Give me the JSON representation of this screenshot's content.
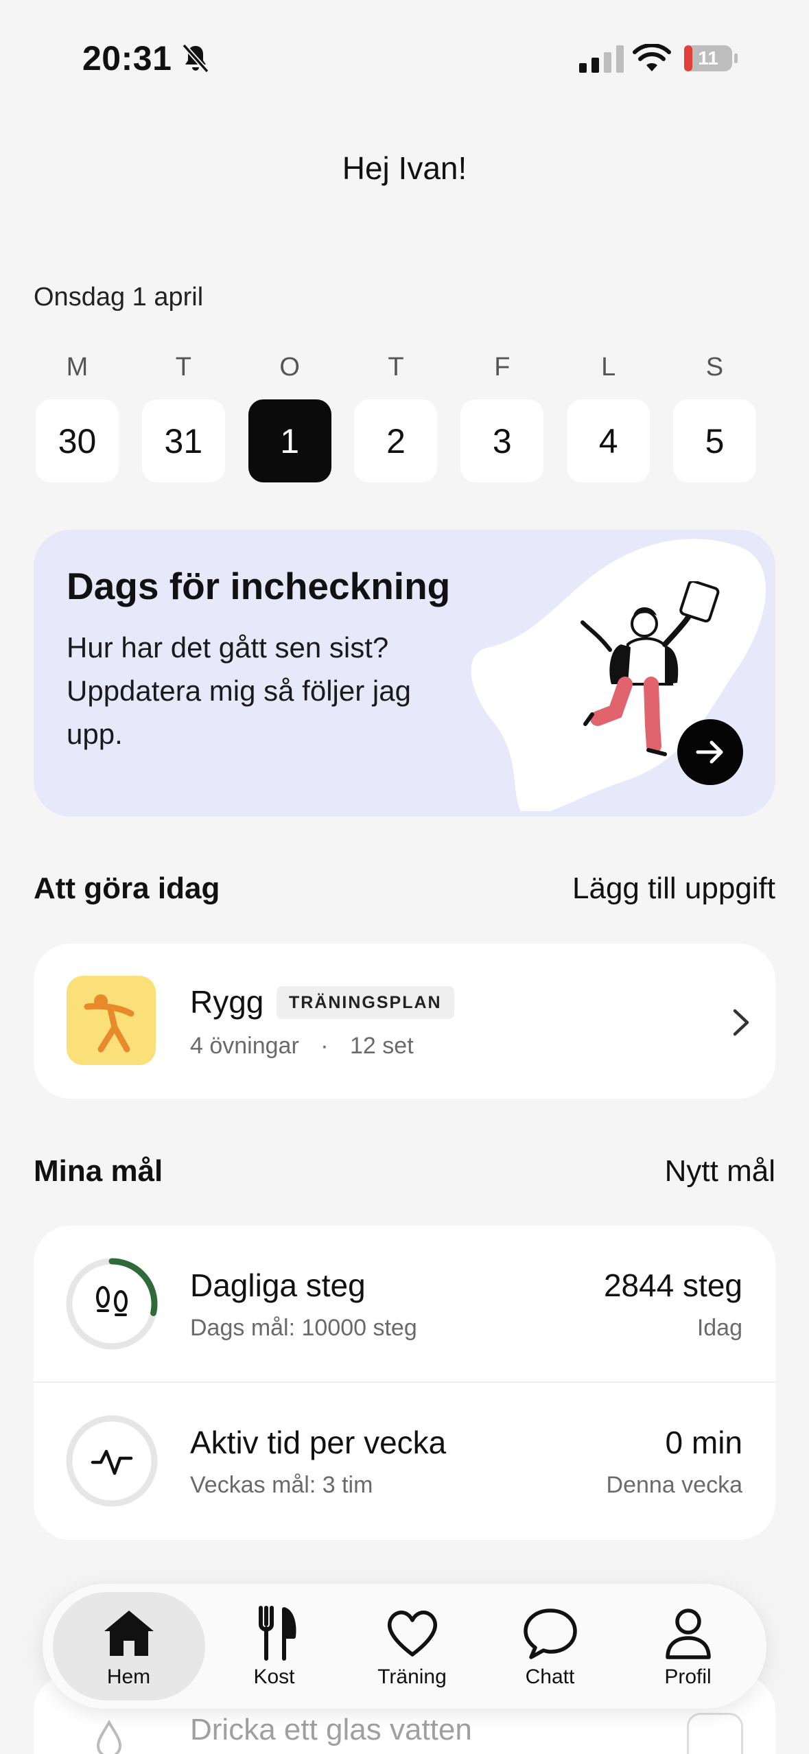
{
  "status_bar": {
    "time": "20:31",
    "battery": "11"
  },
  "greeting": "Hej Ivan!",
  "date_label": "Onsdag 1 april",
  "week": [
    {
      "letter": "M",
      "day": "30"
    },
    {
      "letter": "T",
      "day": "31"
    },
    {
      "letter": "O",
      "day": "1"
    },
    {
      "letter": "T",
      "day": "2"
    },
    {
      "letter": "F",
      "day": "3"
    },
    {
      "letter": "L",
      "day": "4"
    },
    {
      "letter": "S",
      "day": "5"
    }
  ],
  "selected_day": "1",
  "checkin": {
    "title": "Dags för incheckning",
    "text": "Hur har det gått sen sist? Uppdatera mig så följer jag upp."
  },
  "todo": {
    "title": "Att göra idag",
    "add_link": "Lägg till uppgift",
    "task": {
      "name": "Rygg",
      "badge": "TRÄNINGSPLAN",
      "exercises": "4 övningar",
      "separator": "·",
      "sets": "12 set"
    }
  },
  "goals": {
    "title": "Mina mål",
    "new_link": "Nytt mål",
    "items": [
      {
        "name": "Dagliga steg",
        "target": "Dags mål: 10000 steg",
        "value": "2844 steg",
        "period": "Idag",
        "progress": 0.2844,
        "icon": "footsteps-icon"
      },
      {
        "name": "Aktiv tid per vecka",
        "target": "Veckas mål: 3 tim",
        "value": "0 min",
        "period": "Denna vecka",
        "progress": 0,
        "icon": "activity-pulse-icon"
      }
    ]
  },
  "hidden_section": {
    "task": "Dricka ett glas vatten"
  },
  "tabs": [
    {
      "label": "Hem",
      "icon": "home-icon",
      "active": true
    },
    {
      "label": "Kost",
      "icon": "fork-knife-icon",
      "active": false
    },
    {
      "label": "Träning",
      "icon": "heart-icon",
      "active": false
    },
    {
      "label": "Chatt",
      "icon": "chat-bubble-icon",
      "active": false
    },
    {
      "label": "Profil",
      "icon": "person-icon",
      "active": false
    }
  ],
  "colors": {
    "background": "#f5f5f5",
    "checkin_bg": "#e8e8fb",
    "selected_day_bg": "#0b0b0b",
    "task_icon_bg": "#fbe07a",
    "task_icon_fg": "#e8892b",
    "progress_ring": "#2f6b3a",
    "battery_low": "#e0403a"
  }
}
